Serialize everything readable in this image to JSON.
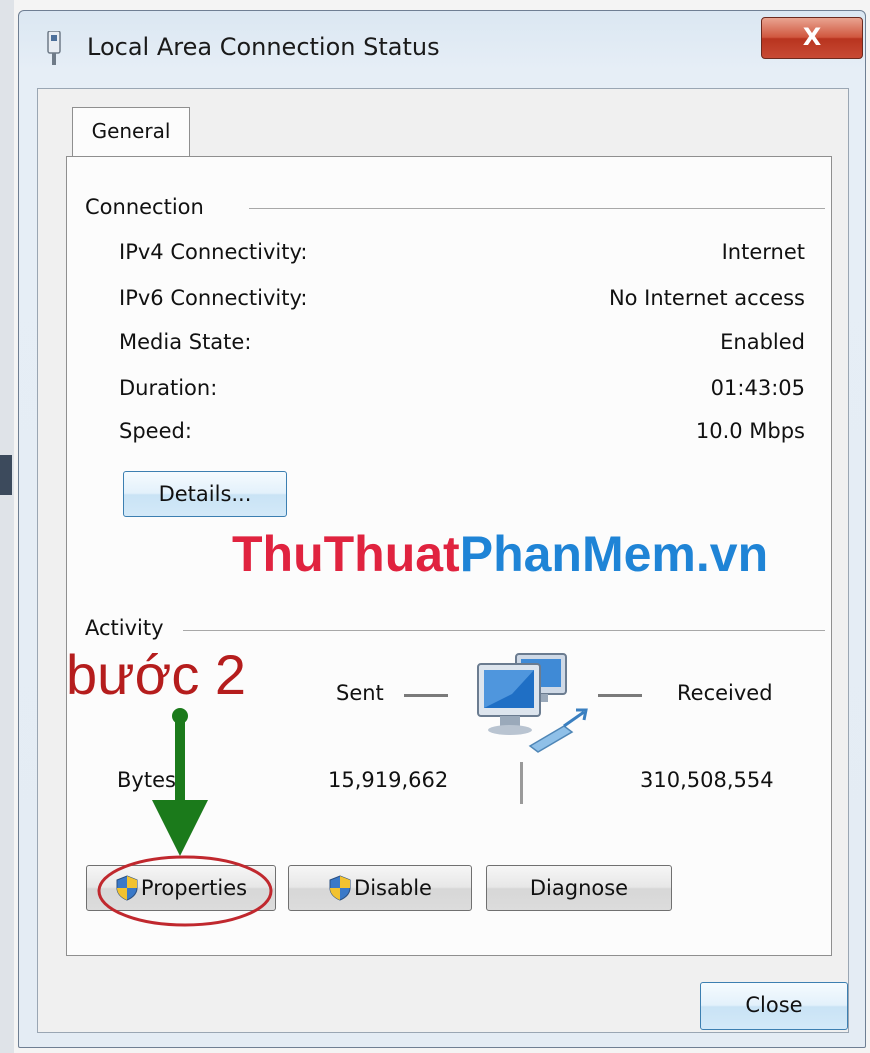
{
  "window": {
    "title": "Local Area Connection Status",
    "close_label": "X"
  },
  "tabs": [
    {
      "label": "General"
    }
  ],
  "connection": {
    "group_label": "Connection",
    "rows": [
      {
        "label": "IPv4 Connectivity:",
        "value": "Internet"
      },
      {
        "label": "IPv6 Connectivity:",
        "value": "No Internet access"
      },
      {
        "label": "Media State:",
        "value": "Enabled"
      },
      {
        "label": "Duration:",
        "value": "01:43:05"
      },
      {
        "label": "Speed:",
        "value": "10.0 Mbps"
      }
    ],
    "details_button": "Details..."
  },
  "activity": {
    "group_label": "Activity",
    "sent_label": "Sent",
    "received_label": "Received",
    "bytes_label": "Bytes",
    "bytes_sent": "15,919,662",
    "bytes_received": "310,508,554"
  },
  "buttons": {
    "properties": "Properties",
    "disable": "Disable",
    "diagnose": "Diagnose",
    "close": "Close"
  },
  "watermark": {
    "part1": "ThuThuat",
    "part2": "PhanMem.vn"
  },
  "annotation": {
    "step_label": "bước 2"
  },
  "icons": {
    "title": "network-adapter-icon",
    "activity": "network-computers-icon",
    "uac": "uac-shield-icon"
  },
  "colors": {
    "accent": "#3c7fb1",
    "annotation_red": "#b51d1d",
    "annotation_green": "#1b7a1b",
    "watermark_red": "#e0233f",
    "watermark_blue": "#1f84d6"
  }
}
